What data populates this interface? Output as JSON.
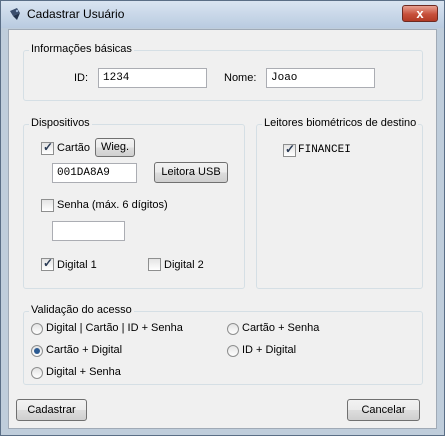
{
  "window": {
    "title": "Cadastrar Usuário",
    "close_label": "x"
  },
  "basic": {
    "legend": "Informações básicas",
    "id_label": "ID:",
    "id_value": "1234",
    "name_label": "Nome:",
    "name_value": "Joao"
  },
  "devices": {
    "legend": "Dispositivos",
    "card_label": "Cartão",
    "card_checked": true,
    "wieg_button": "Wieg.",
    "card_value": "001DA8A9",
    "usb_button": "Leitora USB",
    "password_label": "Senha (máx. 6 dígitos)",
    "password_checked": false,
    "password_value": "",
    "digital1_label": "Digital 1",
    "digital1_checked": true,
    "digital2_label": "Digital 2",
    "digital2_checked": false
  },
  "readers": {
    "legend": "Leitores biométricos de destino",
    "items": [
      {
        "label": "FINANCEI",
        "checked": true
      }
    ]
  },
  "validation": {
    "legend": "Validação do acesso",
    "options": [
      {
        "label": "Digital | Cartão | ID + Senha",
        "selected": false
      },
      {
        "label": "Cartão + Senha",
        "selected": false
      },
      {
        "label": "Cartão + Digital",
        "selected": true
      },
      {
        "label": "ID + Digital",
        "selected": false
      },
      {
        "label": "Digital + Senha",
        "selected": false
      }
    ]
  },
  "footer": {
    "register_button": "Cadastrar",
    "cancel_button": "Cancelar"
  },
  "colors": {
    "accent": "#2b5a92",
    "titlebar": "#c9d8ea",
    "close": "#c7503b"
  }
}
